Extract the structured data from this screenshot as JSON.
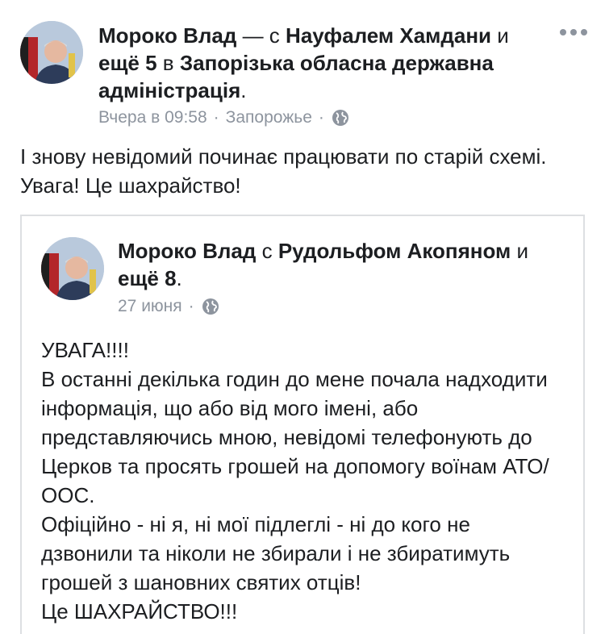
{
  "post": {
    "author": "Мороко Влад",
    "sep_with": "— с",
    "tagged_person": "Науфалем Хамдани",
    "and_word": "и",
    "others": "ещё 5",
    "in_word": "в",
    "place": "Запорізька обласна державна адміністрація",
    "end_punct": ".",
    "time": "Вчера в 09:58",
    "dot1": "·",
    "location": "Запорожье",
    "dot2": "·",
    "privacy_icon": "globe-icon",
    "text": "І знову невідомий починає працювати по старій схемі. Увага! Це шахрайство!"
  },
  "shared_post": {
    "author": "Мороко Влад",
    "with_word": "с",
    "tagged_person": "Рудольфом Акопяном",
    "and_word": "и",
    "others": "ещё 8",
    "end_punct": ".",
    "date": "27 июня",
    "dot": "·",
    "privacy_icon": "globe-icon",
    "text": "УВАГА!!!!\nВ останні декілька годин до мене почала надходити інформація, що або від мого імені, або представляючись мною, невідомі телефонують до Церков та просять грошей на допомогу воїнам АТО/ООС.\nОфіційно - ні я, ні мої підлеглі - ні до кого не дзвонили та ніколи не збирали і не збиратимуть грошей з шановних святих отців!\n Це ШАХРАЙСТВО!!!"
  },
  "colors": {
    "text": "#1c1e21",
    "meta": "#8d949e",
    "border": "#dddfe2"
  }
}
